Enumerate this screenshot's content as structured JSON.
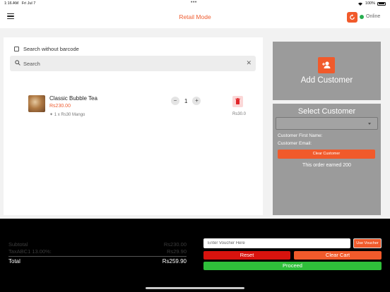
{
  "status_bar": {
    "time": "1:16 AM",
    "date": "Fri Jul 7",
    "dots": "•••",
    "battery": "100%"
  },
  "header": {
    "title": "Retail Mode",
    "connection_status": "Online",
    "accent_color": "#f15a2b",
    "online_color": "#27ae4f"
  },
  "search": {
    "without_barcode_label": "Search without barcode",
    "placeholder": "Search",
    "clear_glyph": "✕"
  },
  "cart": {
    "items": [
      {
        "name": "Classic Bubble Tea",
        "price": "Rs230.00",
        "modifier": "1 x Rs30 Mango",
        "quantity": "1",
        "line_total": "Rs30.0"
      }
    ]
  },
  "customer": {
    "add_label": "Add Customer",
    "select_title": "Select Customer",
    "first_name_label": "Customer First Name:",
    "email_label": "Customer Email:",
    "clear_label": "Clear Customer",
    "earned_text": "This order earned 200"
  },
  "summary": {
    "subtotal_label": "Subtotal",
    "subtotal_value": "Rs230.00",
    "tax_label": "TaxABC1 13.00%:",
    "tax_value": "Rs29.90",
    "total_label": "Total",
    "total_value": "Rs259.90"
  },
  "actions": {
    "voucher_placeholder": "Enter Voucher Here",
    "use_voucher_label": "Use Voucher",
    "reset_label": "Reset",
    "clear_cart_label": "Clear Cart",
    "proceed_label": "Proceed",
    "reset_color": "#d8130e",
    "proceed_color": "#2fbf3a"
  }
}
